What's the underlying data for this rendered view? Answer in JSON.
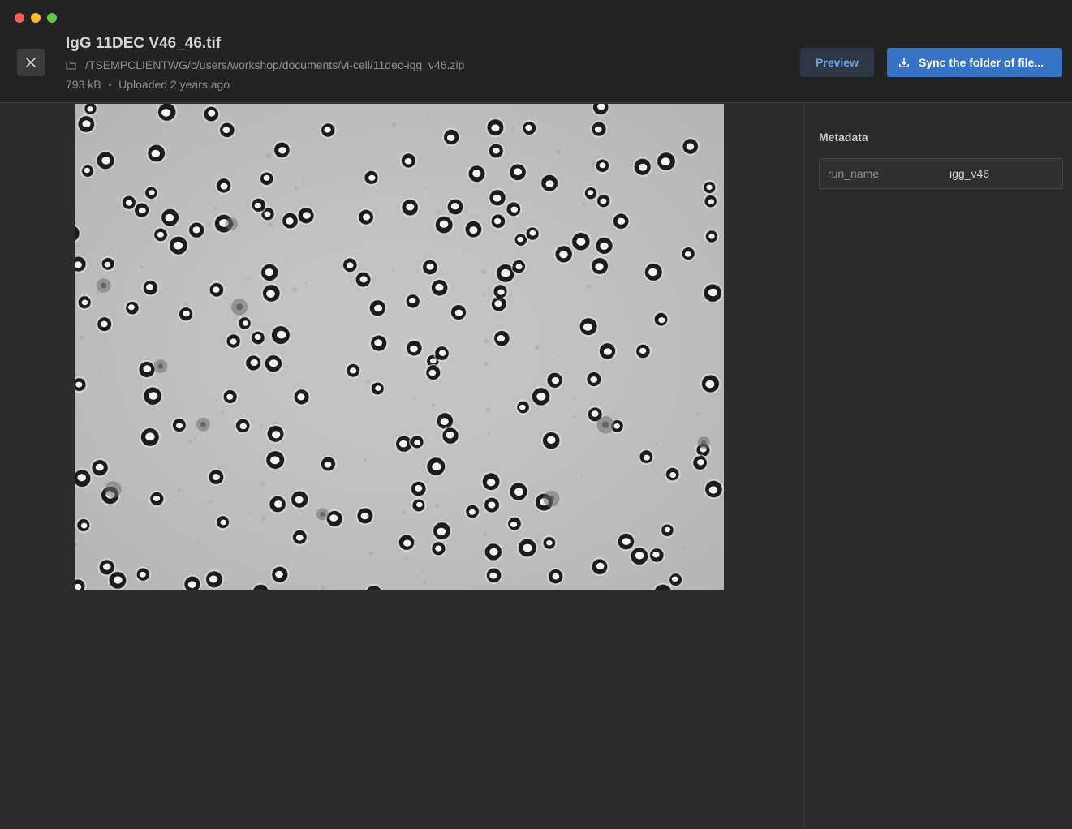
{
  "window": {
    "controls": [
      "close",
      "minimize",
      "zoom"
    ]
  },
  "file": {
    "title": "IgG 11DEC V46_46.tif",
    "path": "/TSEMPCLIENTWG/c/users/workshop/documents/vi-cell/11dec-igg_v46.zip",
    "size": "793 kB",
    "separator": "•",
    "uploaded": "Uploaded 2 years ago"
  },
  "actions": {
    "preview_label": "Preview",
    "sync_label": "Sync the folder of file..."
  },
  "image": {
    "description_kind": "microscope brightfield cell image"
  },
  "metadata": {
    "heading": "Metadata",
    "rows": [
      {
        "key": "run_name",
        "value": "igg_v46"
      }
    ]
  },
  "colors": {
    "header_bg": "#232323",
    "body_bg": "#2c2c2c",
    "accent": "#3773c4",
    "preview_text": "#6aa3e4"
  },
  "icons": {
    "close": "close-icon",
    "folder": "folder-icon",
    "download": "download-icon"
  }
}
